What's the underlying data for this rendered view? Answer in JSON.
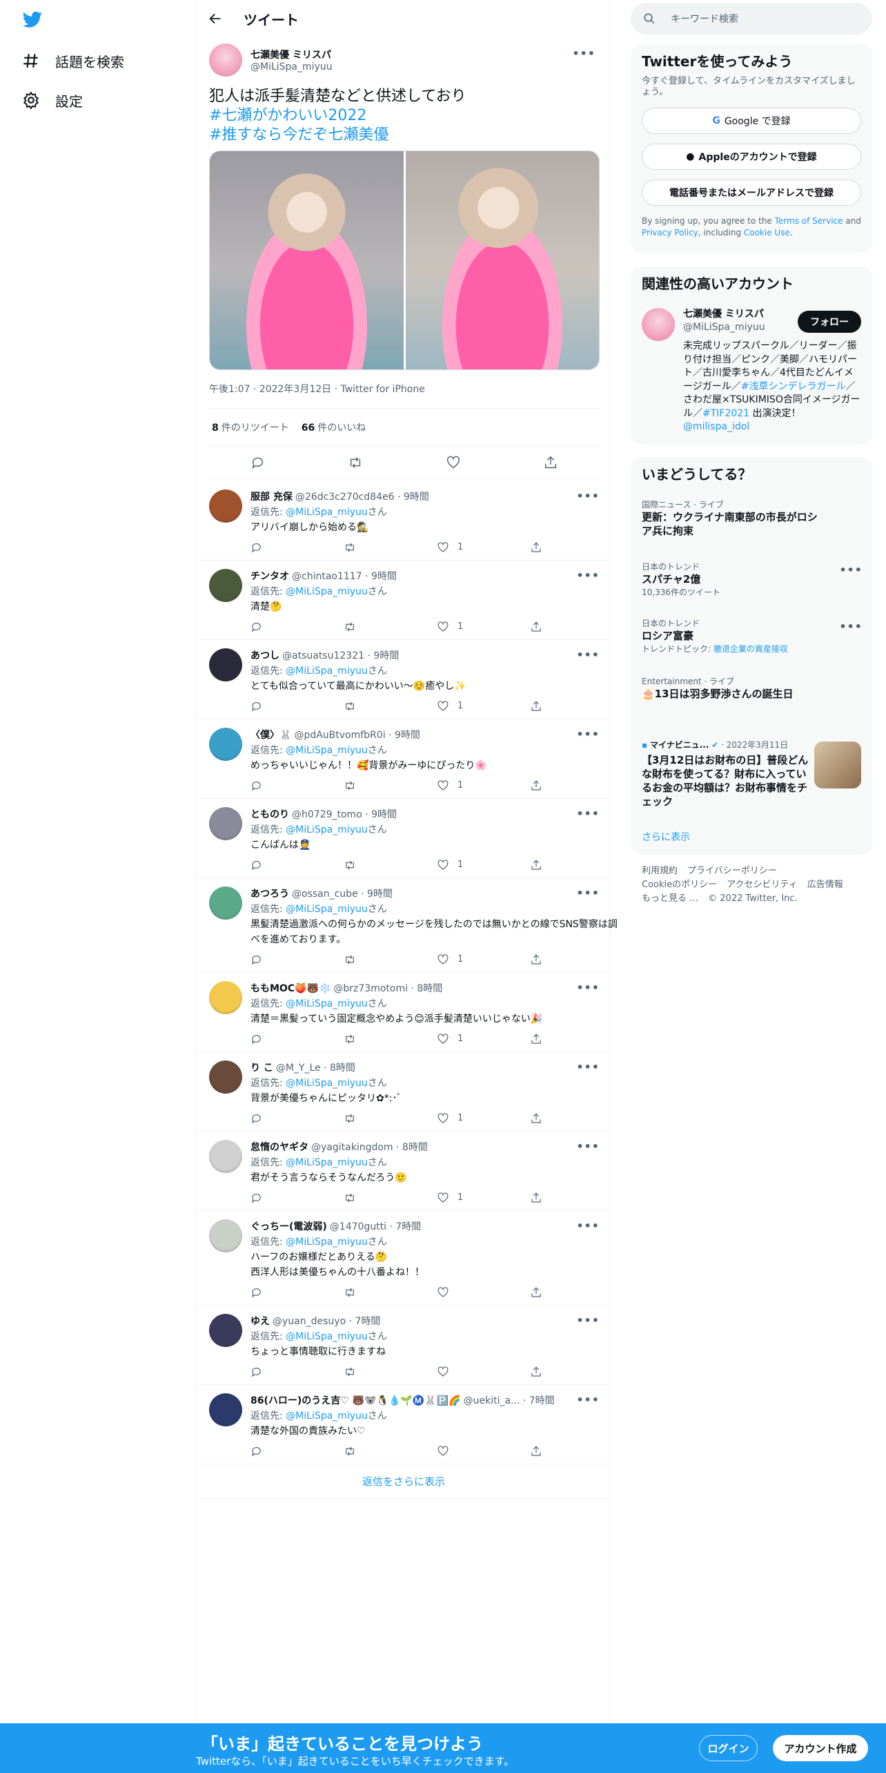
{
  "nav": {
    "explore": "話題を検索",
    "settings": "設定"
  },
  "header": {
    "title": "ツイート"
  },
  "tweet": {
    "name": "七瀬美優 ミリスパ",
    "handle": "@MiLiSpa_miyuu",
    "line1": "犯人は派手髪清楚などと供述しており",
    "tag1": "#七瀬がかわいい2022",
    "tag2": "#推すなら今だぞ七瀬美優",
    "meta": "午後1:07 · 2022年3月12日 · Twitter for iPhone",
    "retweets": "8",
    "retweets_label": "件のリツイート",
    "likes": "66",
    "likes_label": "件のいいね"
  },
  "reply_to_label": "返信先: ",
  "reply_to_handle": "@MiLiSpa_miyuu",
  "reply_to_suffix": "さん",
  "replies": [
    {
      "name": "服部 充保",
      "handle": "@26dc3c270cd84e6 · 9時間",
      "text": "アリバイ崩しから始める🕵️",
      "likes": "1",
      "color": "#a0522d"
    },
    {
      "name": "チンタオ",
      "handle": "@chintao1117 · 9時間",
      "text": "清楚🤔",
      "likes": "1",
      "color": "#4a5a3a"
    },
    {
      "name": "あつし",
      "handle": "@atsuatsu12321 · 9時間",
      "text": "とても似合っていて最高にかわいい〜☺️癒やし✨",
      "likes": "1",
      "color": "#2a2a3a"
    },
    {
      "name": "〈僕〉🐰",
      "handle": "@pdAuBtvomfbR0i · 9時間",
      "text": "めっちゃいいじゃん！！🥰背景がみーゆにぴったり🌸",
      "likes": "1",
      "color": "#3aa0c8"
    },
    {
      "name": "とものり",
      "handle": "@h0729_tomo · 9時間",
      "text": "こんばんは👮",
      "likes": "1",
      "color": "#8a8a9a"
    },
    {
      "name": "あつろう",
      "handle": "@ossan_cube · 9時間",
      "text": "黒髪清楚過激派への何らかのメッセージを残したのでは無いかとの線でSNS警察は調べを進めております。",
      "likes": "1",
      "color": "#5aaa8a"
    },
    {
      "name": "ももMOC🍑🐻❄️",
      "handle": "@brz73motomi · 8時間",
      "text": "清楚＝黒髪っていう固定概念やめよう😊派手髪清楚いいじゃない🎉",
      "likes": "1",
      "color": "#f2c94c"
    },
    {
      "name": "り こ",
      "handle": "@M_Y_Le · 8時間",
      "text": "背景が美優ちゃんにピッタリ✿*:･ﾟ",
      "likes": "1",
      "color": "#6a4a3a"
    },
    {
      "name": "怠惰のヤギタ",
      "handle": "@yagitakingdom · 8時間",
      "text": "君がそう言うならそうなんだろう🙂",
      "likes": "1",
      "color": "#d0d0d0"
    },
    {
      "name": "ぐっちー(電波弱)",
      "handle": "@1470gutti · 7時間",
      "text": "ハーフのお嬢様だとありえる🤔",
      "text2": "西洋人形は美優ちゃんの十八番よね！！",
      "likes": "",
      "color": "#c8d0c8"
    },
    {
      "name": "ゆえ",
      "handle": "@yuan_desuyo · 7時間",
      "text": "ちょっと事情聴取に行きますね",
      "likes": "",
      "color": "#3a3a5a"
    },
    {
      "name": "86(ハロー)のうえ吉♡ 🐻🐨🐧💧🌱Ⓜ️🐰🅿️🌈",
      "handle": "@uekiti_a... · 7時間",
      "text": "清楚な外国の貴族みたい♡",
      "likes": "",
      "color": "#2a3a6a"
    }
  ],
  "show_more_replies": "返信をさらに表示",
  "right": {
    "search_placeholder": "キーワード検索",
    "signup_title": "Twitterを使ってみよう",
    "signup_sub": "今すぐ登録して、タイムラインをカスタマイズしましょう。",
    "google": "Google で登録",
    "apple": "Appleのアカウントで登録",
    "phone": "電話番号またはメールアドレスで登録",
    "terms1": "By signing up, you agree to the ",
    "terms_tos": "Terms of Service",
    "terms2": " and ",
    "terms_pp": "Privacy Policy",
    "terms3": ", including ",
    "terms_cookie": "Cookie Use",
    "terms4": ".",
    "related_title": "関連性の高いアカウント",
    "acct_name": "七瀬美優 ミリスパ",
    "acct_handle": "@MiLiSpa_miyuu",
    "follow": "フォロー",
    "bio1": "未完成リップスパークル／リーダー／振り付け担当／ピンク／美脚／ハモリパート／古川愛李ちゃん／4代目たどんイメージガール／",
    "bio_link1": "#浅草シンデレラガール",
    "bio2": "／さわだ屋×TSUKIMISO合同イメージガール／",
    "bio_link2": "#TIF2021",
    "bio3": " 出演決定！ ",
    "bio_link3": "@milispa_idol",
    "happening_title": "いまどうしてる？",
    "trends": [
      {
        "cat": "国際ニュース · ライブ",
        "name": "更新：ウクライナ南東部の市長がロシア兵に拘束",
        "sub": ""
      },
      {
        "cat": "日本のトレンド",
        "name": "スパチャ2億",
        "sub": "10,336件のツイート"
      },
      {
        "cat": "日本のトレンド",
        "name": "ロシア富豪",
        "sub": "トレンドトピック: ",
        "sublink": "撤退企業の資産接収"
      },
      {
        "cat": "Entertainment · ライブ",
        "name": "🎂13日は羽多野渉さんの誕生日",
        "sub": ""
      }
    ],
    "news_source": "マイナビニュ...",
    "news_date": " · 2022年3月11日",
    "news_title": "【3月12日はお財布の日】普段どんな財布を使ってる？財布に入っているお金の平均額は？お財布事情をチェック",
    "more": "さらに表示",
    "footer": [
      "利用規約",
      "プライバシーポリシー",
      "Cookieのポリシー",
      "アクセシビリティ",
      "広告情報",
      "もっと見る …",
      "© 2022 Twitter, Inc."
    ]
  },
  "bottom": {
    "title": "「いま」起きていることを見つけよう",
    "sub": "Twitterなら、「いま」起きていることをいち早くチェックできます。",
    "login": "ログイン",
    "signup": "アカウント作成"
  }
}
